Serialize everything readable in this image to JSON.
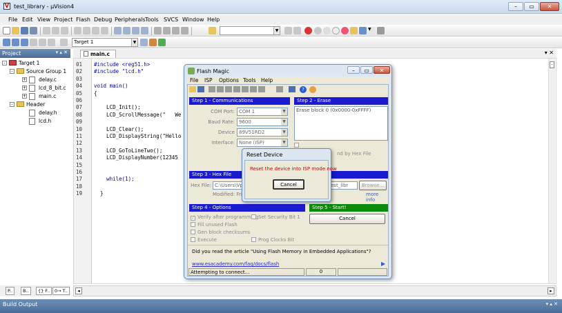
{
  "app": {
    "title": "test_library - µVision4"
  },
  "menu": [
    "File",
    "Edit",
    "View",
    "Project",
    "Flash",
    "Debug",
    "Peripherals",
    "Tools",
    "SVCS",
    "Window",
    "Help"
  ],
  "toolbar2": {
    "target": "Target 1"
  },
  "project_panel": {
    "title": "Project",
    "tree": [
      {
        "label": "Target 1",
        "level": 0,
        "icon": "target-icon",
        "expand": "-"
      },
      {
        "label": "Source Group 1",
        "level": 1,
        "icon": "folder-icon",
        "expand": "-"
      },
      {
        "label": "delay.c",
        "level": 2,
        "icon": "file-icon",
        "expand": "+"
      },
      {
        "label": "lcd_8_bit.c",
        "level": 2,
        "icon": "file-icon",
        "expand": "+"
      },
      {
        "label": "main.c",
        "level": 2,
        "icon": "file-icon",
        "expand": "+"
      },
      {
        "label": "Header",
        "level": 1,
        "icon": "folder-icon",
        "expand": "-"
      },
      {
        "label": "delay.h",
        "level": 2,
        "icon": "file-icon",
        "expand": ""
      },
      {
        "label": "lcd.h",
        "level": 2,
        "icon": "file-icon",
        "expand": ""
      }
    ],
    "tabs": [
      "P..",
      "B..",
      "{} F..",
      "0→ T.."
    ]
  },
  "editor": {
    "tab": "main.c",
    "lines": [
      {
        "n": "01",
        "code": "#include <reg51.h>"
      },
      {
        "n": "02",
        "code": "#include \"lcd.h\""
      },
      {
        "n": "03",
        "code": ""
      },
      {
        "n": "04",
        "code": "void main()"
      },
      {
        "n": "05",
        "code": "{"
      },
      {
        "n": "06",
        "code": ""
      },
      {
        "n": "07",
        "code": "    LCD_Init();"
      },
      {
        "n": "08",
        "code": "    LCD_ScrollMessage(\"   We"
      },
      {
        "n": "09",
        "code": ""
      },
      {
        "n": "10",
        "code": "    LCD_Clear();"
      },
      {
        "n": "11",
        "code": "    LCD_DisplayString(\"Hello"
      },
      {
        "n": "12",
        "code": ""
      },
      {
        "n": "13",
        "code": "    LCD_GoToLineTwo();"
      },
      {
        "n": "14",
        "code": "    LCD_DisplayNumber(12345"
      },
      {
        "n": "15",
        "code": ""
      },
      {
        "n": "16",
        "code": ""
      },
      {
        "n": "17",
        "code": "    while(1);"
      },
      {
        "n": "18",
        "code": ""
      },
      {
        "n": "19",
        "code": "  }"
      }
    ]
  },
  "flash_magic": {
    "title": "Flash Magic",
    "menu": [
      "File",
      "ISP",
      "Options",
      "Tools",
      "Help"
    ],
    "step1": {
      "title": "Step 1 - Communications",
      "com_port_label": "COM Port:",
      "com_port": "COM 1",
      "baud_label": "Baud Rate:",
      "baud": "9600",
      "device_label": "Device",
      "device": "89V51RD2",
      "interface_label": "Interface:",
      "interface": "None (ISP)"
    },
    "step2": {
      "title": "Step 2 - Erase",
      "list_item": "Erase block 0 (0x0000-0xFFFF)",
      "partial": "nd by Hex File"
    },
    "step3": {
      "title": "Step 3 - Hex File",
      "hex_label": "Hex File:",
      "hex_path": "C:\\Users\\Vplo",
      "hex_path_end": "est_libr",
      "browse": "Browse...",
      "modified": "Modified: Friday",
      "more_info": "more info"
    },
    "step4": {
      "title": "Step 4 - Options",
      "verify": "Verify after programming",
      "security": "Set Security Bit 1",
      "fill": "Fill unused Flash",
      "gen": "Gen block checksums",
      "execute": "Execute",
      "prog": "Prog Clocks Bit"
    },
    "step5": {
      "title": "Step 5 - Start!",
      "cancel": "Cancel"
    },
    "article": "Did you read the article \"Using Flash Memory in Embedded Applications\"?",
    "link": "www.esacademy.com/faq/docs/flash",
    "status": "Attempting to connect...",
    "status_num": "0"
  },
  "reset_dialog": {
    "title": "Reset Device",
    "message": "Reset the device into ISP mode now",
    "cancel": "Cancel"
  },
  "build_output": {
    "title": "Build Output"
  }
}
